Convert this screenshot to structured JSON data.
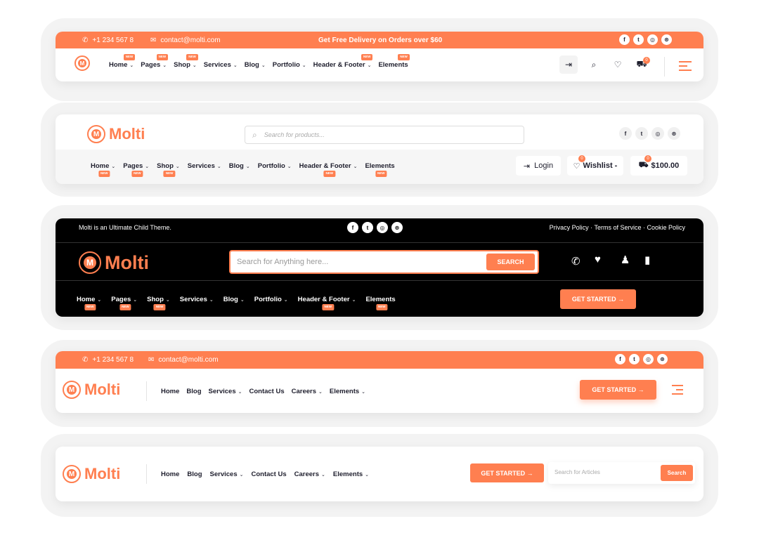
{
  "variant1": {
    "phone": "+1 234 567 8",
    "email": "contact@molti.com",
    "promo": "Get Free Delivery on Orders over $60",
    "nav": [
      {
        "label": "Home",
        "badge": "NEW"
      },
      {
        "label": "Pages",
        "badge": "NEW"
      },
      {
        "label": "Shop",
        "badge": "NEW"
      },
      {
        "label": "Services",
        "badge": ""
      },
      {
        "label": "Blog",
        "badge": ""
      },
      {
        "label": "Portfolio",
        "badge": ""
      },
      {
        "label": "Header & Footer",
        "badge": "NEW"
      },
      {
        "label": "Elements",
        "badge": "NEW"
      }
    ],
    "cart_count": "0"
  },
  "variant2": {
    "logo": "Molti",
    "search_placeholder": "Search for products...",
    "nav": [
      {
        "label": "Home",
        "badge": "NEW"
      },
      {
        "label": "Pages",
        "badge": "NEW"
      },
      {
        "label": "Shop",
        "badge": "NEW"
      },
      {
        "label": "Services",
        "badge": ""
      },
      {
        "label": "Blog",
        "badge": ""
      },
      {
        "label": "Portfolio",
        "badge": ""
      },
      {
        "label": "Header & Footer",
        "badge": "NEW"
      },
      {
        "label": "Elements",
        "badge": "NEW"
      }
    ],
    "login": "Login",
    "wishlist": "Wishlist -",
    "wishlist_count": "0",
    "cart_total": "$100.00",
    "cart_count": "0"
  },
  "variant3": {
    "tagline": "Molti is an Ultimate Child Theme.",
    "links": "Privacy Policy · Terms of Service · Cookie Policy",
    "logo": "Molti",
    "search_placeholder": "Search for Anything here...",
    "search_button": "SEARCH",
    "nav": [
      {
        "label": "Home",
        "badge": "NEW"
      },
      {
        "label": "Pages",
        "badge": "NEW"
      },
      {
        "label": "Shop",
        "badge": "NEW"
      },
      {
        "label": "Services",
        "badge": ""
      },
      {
        "label": "Blog",
        "badge": ""
      },
      {
        "label": "Portfolio",
        "badge": ""
      },
      {
        "label": "Header & Footer",
        "badge": "NEW"
      },
      {
        "label": "Elements",
        "badge": "NEW"
      }
    ],
    "cta": "GET STARTED →"
  },
  "variant4": {
    "phone": "+1 234 567 8",
    "email": "contact@molti.com",
    "logo": "Molti",
    "nav": [
      "Home",
      "Blog",
      "Services",
      "Contact Us",
      "Careers",
      "Elements"
    ],
    "cta": "GET STARTED →"
  },
  "variant5": {
    "logo": "Molti",
    "nav": [
      "Home",
      "Blog",
      "Services",
      "Contact Us",
      "Careers",
      "Elements"
    ],
    "cta": "GET STARTED →",
    "search_placeholder": "Search for Articles",
    "search_button": "Search"
  },
  "colors": {
    "accent": "#ff7f50",
    "dark": "#000000"
  }
}
